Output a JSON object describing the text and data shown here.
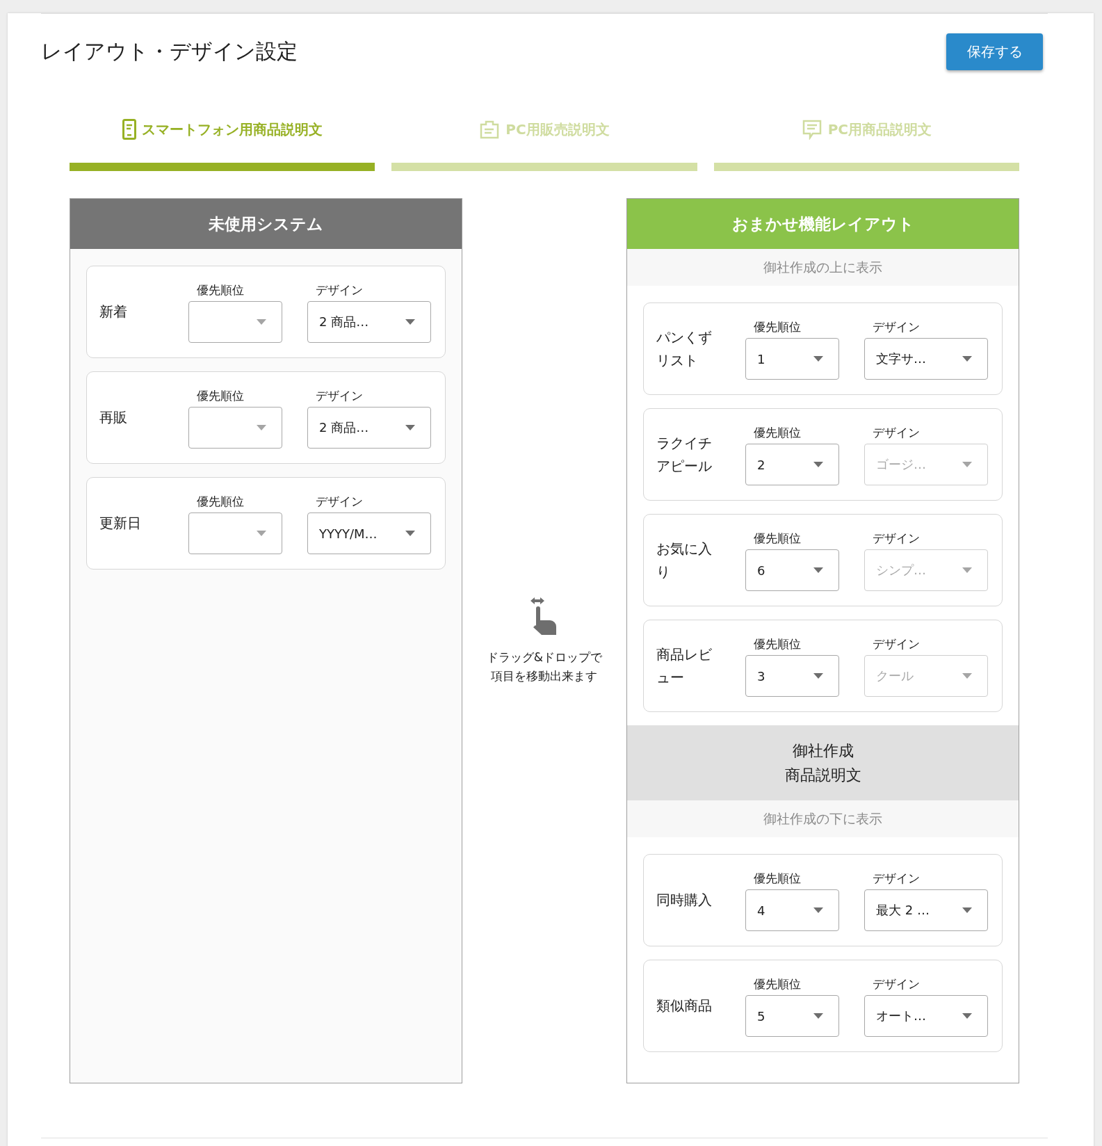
{
  "title": "レイアウト・デザイン設定",
  "save_button": "保存する",
  "tabs": [
    {
      "label": "スマートフォン用商品説明文",
      "selected": true
    },
    {
      "label": "PC用販売説明文",
      "selected": false
    },
    {
      "label": "PC用商品説明文",
      "selected": false
    }
  ],
  "unused_panel": {
    "title": "未使用システム",
    "items": [
      {
        "name": "新着",
        "priority_label": "優先順位",
        "design_label": "デザイン",
        "design": "2 商品…",
        "design_disabled": false
      },
      {
        "name": "再販",
        "priority_label": "優先順位",
        "design_label": "デザイン",
        "design": "2 商品…",
        "design_disabled": false
      },
      {
        "name": "更新日",
        "priority_label": "優先順位",
        "design_label": "デザイン",
        "design": "YYYY/M…",
        "design_disabled": false
      }
    ]
  },
  "drag_hint": [
    "ドラッグ&ドロップで",
    "項目を移動出来ます"
  ],
  "layout_panel": {
    "title": "おまかせ機能レイアウト",
    "above_label": "御社作成の上に表示",
    "above_items": [
      {
        "name": "パンくずリスト",
        "priority_label": "優先順位",
        "priority": "1",
        "design_label": "デザイン",
        "design": "文字サ…",
        "design_disabled": false
      },
      {
        "name": "ラクイチアピール",
        "priority_label": "優先順位",
        "priority": "2",
        "design_label": "デザイン",
        "design": "ゴージ…",
        "design_disabled": true
      },
      {
        "name": "お気に入り",
        "priority_label": "優先順位",
        "priority": "6",
        "design_label": "デザイン",
        "design": "シンプ…",
        "design_disabled": true
      },
      {
        "name": "商品レビュー",
        "priority_label": "優先順位",
        "priority": "3",
        "design_label": "デザイン",
        "design": "クール",
        "design_disabled": true
      }
    ],
    "divider_label": [
      "御社作成",
      "商品説明文"
    ],
    "below_label": "御社作成の下に表示",
    "below_items": [
      {
        "name": "同時購入",
        "priority_label": "優先順位",
        "priority": "4",
        "design_label": "デザイン",
        "design": "最大 2 …",
        "design_disabled": false
      },
      {
        "name": "類似商品",
        "priority_label": "優先順位",
        "priority": "5",
        "design_label": "デザイン",
        "design": "オート…",
        "design_disabled": false
      }
    ]
  }
}
